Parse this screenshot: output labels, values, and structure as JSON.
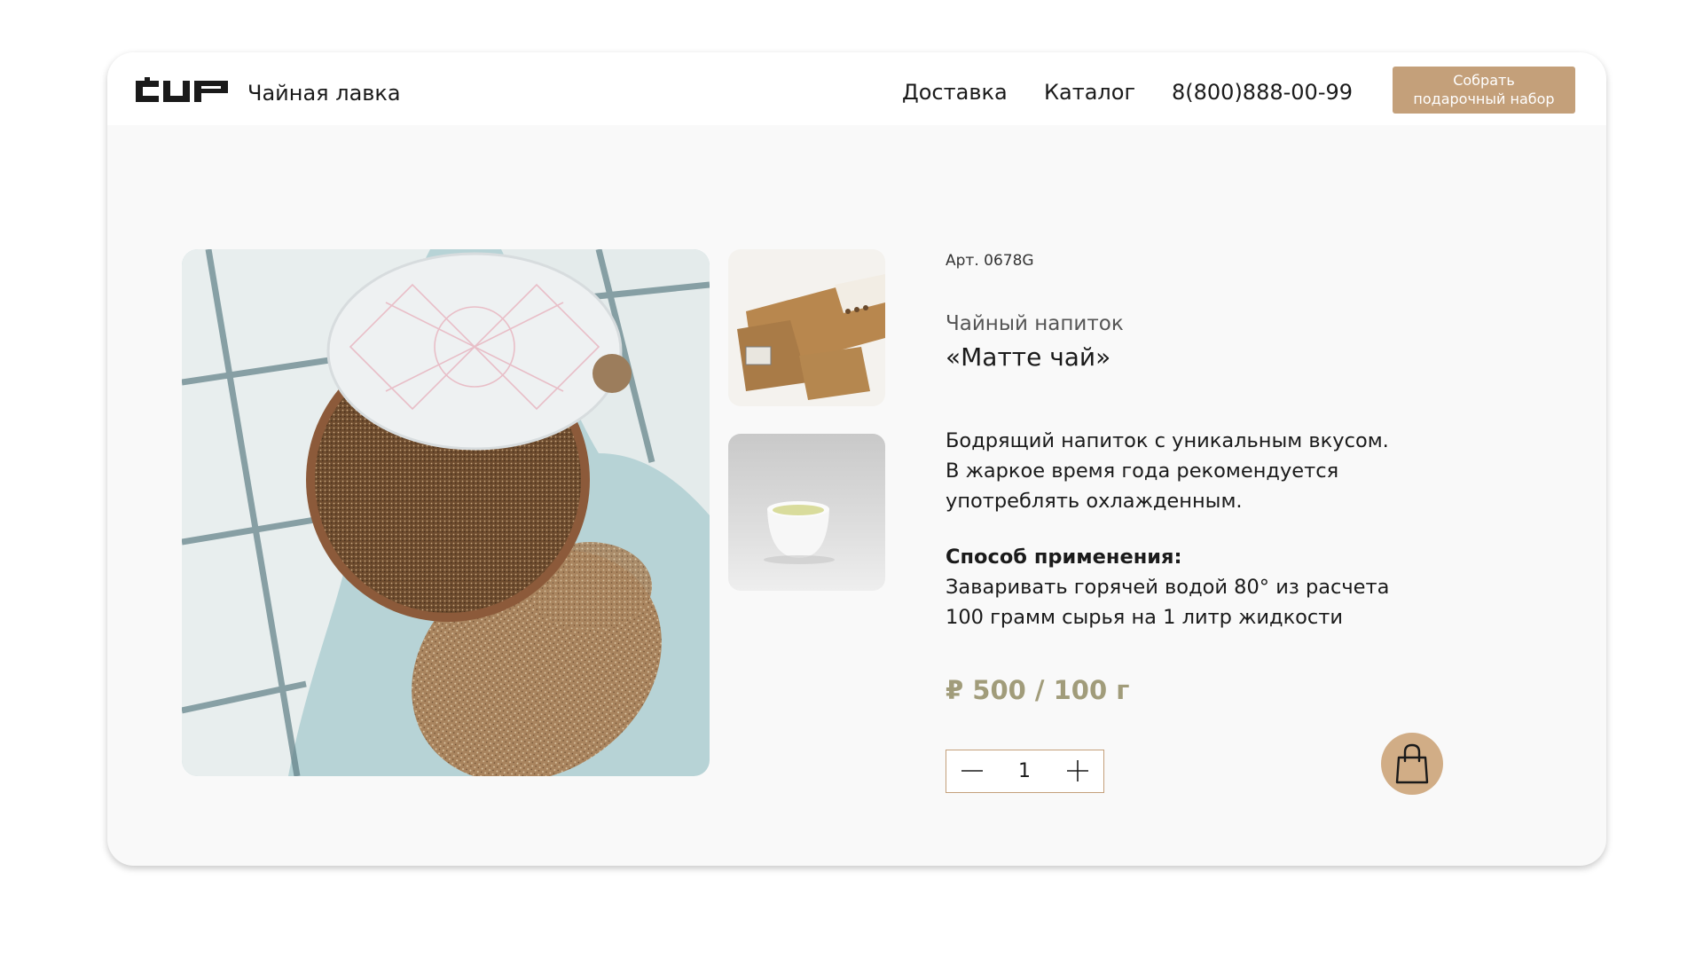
{
  "header": {
    "logo_text": "CUP",
    "shop_name": "Чайная лавка",
    "nav": {
      "delivery": "Доставка",
      "catalog": "Каталог",
      "phone": "8(800)888-00-99"
    },
    "gift_button": {
      "line1": "Собрать",
      "line2": "подарочный набор"
    }
  },
  "gallery": {
    "main_icon": "tea-tin-photo",
    "thumbnails": [
      "tea-boxes-photo",
      "tea-cup-photo"
    ]
  },
  "product": {
    "article": "Арт. 0678G",
    "type": "Чайный напиток",
    "name": "«Матте чай»",
    "description": [
      "Бодрящий напиток с уникальным вкусом.",
      "В жаркое время года рекомендуется",
      "употреблять охлажденным."
    ],
    "usage_title": "Способ применения:",
    "usage_lines": [
      "Заваривать горячей водой 80° из расчета",
      "100 грамм сырья на 1 литр жидкости"
    ],
    "price": "₽ 500 / 100 г",
    "quantity": "1"
  },
  "colors": {
    "accent": "#c4a07a",
    "cart_bg": "#d1ad86",
    "price": "#a19c7a",
    "page_bg": "#f9f9f9"
  },
  "icons": {
    "minus": "minus-icon",
    "plus": "plus-icon",
    "cart": "shopping-bag-icon"
  }
}
